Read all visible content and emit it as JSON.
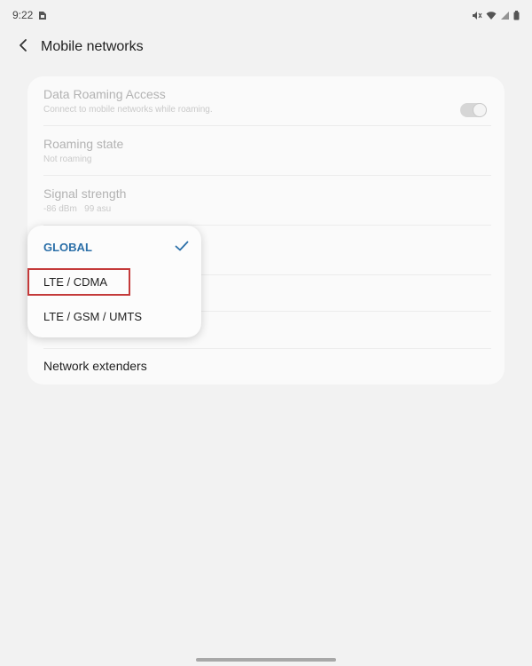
{
  "status_bar": {
    "time": "9:22"
  },
  "app_bar": {
    "title": "Mobile networks"
  },
  "settings": {
    "data_roaming": {
      "title": "Data Roaming Access",
      "subtitle": "Connect to mobile networks while roaming.",
      "toggle_state": "on-disabled"
    },
    "roaming_state": {
      "title": "Roaming state",
      "subtitle": "Not roaming"
    },
    "signal_strength": {
      "title": "Signal strength",
      "subtitle": "-86 dBm   99 asu"
    },
    "network_extenders": {
      "title": "Network extenders"
    }
  },
  "network_mode_menu": {
    "options": [
      {
        "label": "GLOBAL",
        "selected": true
      },
      {
        "label": "LTE / CDMA",
        "selected": false,
        "highlighted": true
      },
      {
        "label": "LTE / GSM / UMTS",
        "selected": false
      }
    ]
  },
  "colors": {
    "accent": "#2b6fa8",
    "highlight": "#c43a3a",
    "background": "#f2f2f2",
    "card": "#fafafa"
  },
  "icons": {
    "back": "arrow-left-icon",
    "check": "checkmark-icon",
    "sim": "sim-card-icon",
    "mute": "vibrate-mute-icon",
    "wifi": "wifi-icon",
    "signal": "cell-signal-icon",
    "battery": "battery-icon"
  }
}
